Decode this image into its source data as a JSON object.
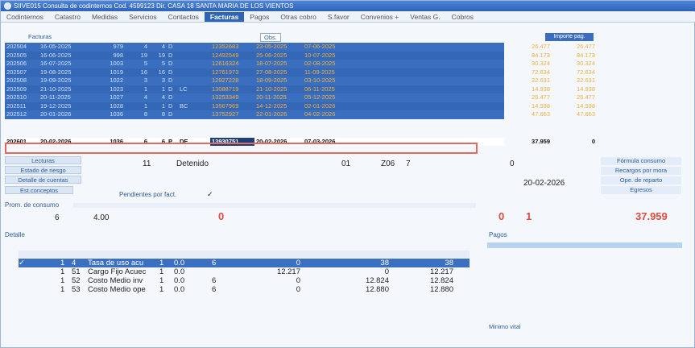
{
  "window": {
    "title": "SIIVE015 Consulta de codinternos Cod. 4599123 Dir. CASA 18 SANTA MARIA DE LOS VIENTOS"
  },
  "tabs": [
    "Codinternos",
    "Catastro",
    "Medidas",
    "Servicios",
    "Contactos",
    "Facturas",
    "Pagos",
    "Otras cobro",
    "S.favor",
    "Convenios +",
    "Ventas G.",
    "Cobros"
  ],
  "active_tab": "Facturas",
  "section_label": "Facturas",
  "obs_label": "Obs.",
  "importe_header": "Importe pag.",
  "rows": [
    [
      "202504",
      "16-05-2025",
      "979",
      "4",
      "4",
      "D",
      "",
      "",
      "12352683",
      "23-05-2025",
      "07-06-2025",
      "26.477",
      "26.477"
    ],
    [
      "202505",
      "16-06-2025",
      "998",
      "19",
      "19",
      "D",
      "",
      "",
      "12492549",
      "25-06-2025",
      "10-07-2025",
      "84.173",
      "84.173"
    ],
    [
      "202506",
      "16-07-2025",
      "1003",
      "5",
      "5",
      "D",
      "",
      "",
      "12616324",
      "18-07-2025",
      "02-08-2025",
      "30.324",
      "30.324"
    ],
    [
      "202507",
      "19-08-2025",
      "1019",
      "16",
      "16",
      "D",
      "",
      "",
      "12761973",
      "27-08-2025",
      "11-09-2025",
      "72.634",
      "72.634"
    ],
    [
      "202508",
      "19-09-2025",
      "1022",
      "3",
      "3",
      "D",
      "",
      "",
      "12927228",
      "18-09-2025",
      "03-10-2025",
      "22.631",
      "22.631"
    ],
    [
      "202509",
      "21-10-2025",
      "1023",
      "1",
      "1",
      "D",
      "LC",
      "",
      "13088719",
      "21-10-2025",
      "06-11-2025",
      "14.938",
      "14.938"
    ],
    [
      "202510",
      "20-11-2025",
      "1027",
      "4",
      "4",
      "D",
      "",
      "",
      "13253349",
      "20-11-2025",
      "05-12-2025",
      "26.477",
      "26.477"
    ],
    [
      "202511",
      "19-12-2025",
      "1028",
      "1",
      "1",
      "D",
      "BC",
      "",
      "13567969",
      "14-12-2025",
      "02-01-2026",
      "14.938",
      "14.938"
    ],
    [
      "202512",
      "20-01-2026",
      "1036",
      "8",
      "8",
      "D",
      "",
      "",
      "13752927",
      "22-01-2026",
      "04-02-2026",
      "47.663",
      "47.663"
    ]
  ],
  "current_row": [
    "202601",
    "20-02-2026",
    "1036",
    "6",
    "6",
    "P",
    "DE",
    "",
    "13930751",
    "20-02-2026",
    "07-03-2026",
    "37.959",
    "0"
  ],
  "left_buttons": [
    "Lecturas",
    "Estado de riesgo",
    "Detalle de cuentas",
    "Est.conceptos"
  ],
  "pendientes_label": "Pendientes por fact.",
  "pendientes_check": "✓",
  "info": {
    "lecturas_n": "11",
    "estado": "Detenido",
    "col_01": "01",
    "zona": "Z06",
    "seven": "7",
    "zero": "0",
    "fecha": "20-02-2026"
  },
  "right_buttons": [
    "Fórmula consumo",
    "Recargos por mora",
    "Ope. de reparto",
    "Egresos"
  ],
  "proom_label": "Prom. de consumo",
  "prom": {
    "v1": "6",
    "v2": "4.00",
    "red0": "0",
    "red_a": "0",
    "red_b": "1",
    "total": "37.959"
  },
  "detalle_label": "Detalle",
  "pagos_label": "Pagos",
  "detail_rows": [
    {
      "chk": "✓",
      "n1": "1",
      "n2": "4",
      "desc": "Tasa de uso acu",
      "q": "1",
      "f": "0.0",
      "g": "6",
      "h": "0",
      "i": "38",
      "j": "38"
    },
    {
      "chk": "",
      "n1": "1",
      "n2": "51",
      "desc": "Cargo Fijo Acuec",
      "q": "1",
      "f": "0.0",
      "g": "",
      "h": "12.217",
      "i": "0",
      "j": "12.217"
    },
    {
      "chk": "",
      "n1": "1",
      "n2": "52",
      "desc": "Costo Medio inv",
      "q": "1",
      "f": "0.0",
      "g": "6",
      "h": "0",
      "i": "12.824",
      "j": "12.824"
    },
    {
      "chk": "",
      "n1": "1",
      "n2": "53",
      "desc": "Costo Medio ope",
      "q": "1",
      "f": "0.0",
      "g": "6",
      "h": "0",
      "i": "12.880",
      "j": "12.880"
    }
  ],
  "minimo_label": "Minimo vital"
}
